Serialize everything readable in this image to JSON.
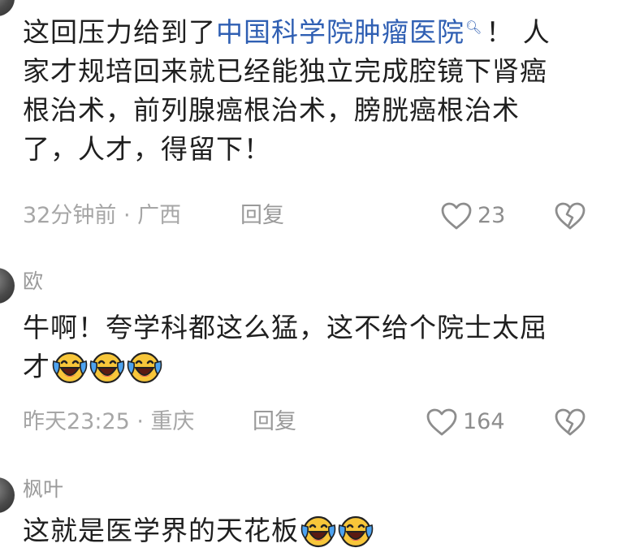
{
  "comments": [
    {
      "text_before_link": "这回压力给到了",
      "link_text": "中国科学院肿瘤医院",
      "search_icon": "search-icon",
      "text_after_link": "！ 人",
      "line2": "家才规培回来就已经能独立完成腔镜下肾癌",
      "line3": "根治术，前列腺癌根治术，膀胱癌根治术",
      "line4": "了，人才，得留下！",
      "time_location": "32分钟前 · 广西",
      "reply_label": "回复",
      "like_count": "23"
    },
    {
      "username": "欧",
      "line1": "牛啊！夸学科都这么猛，这不给个院士太屈",
      "line2": "才",
      "emoji": "laughing-crying-emoji",
      "time_location": "昨天23:25 · 重庆",
      "reply_label": "回复",
      "like_count": "164"
    },
    {
      "username": "枫叶",
      "line1": "这就是医学界的天花板",
      "emoji": "laughing-crying-emoji"
    }
  ],
  "colors": {
    "link": "#2f5fb3",
    "meta_text": "#a6a6a6",
    "body_text": "#1f1f1f"
  }
}
